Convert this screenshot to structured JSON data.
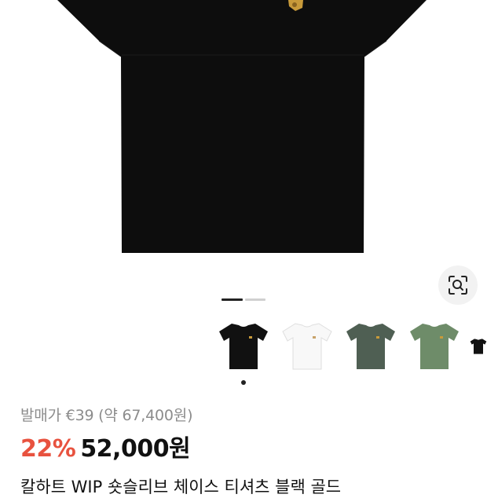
{
  "product": {
    "image": {
      "alt": "black t-shirt product photo",
      "color": "#0d0d0d"
    },
    "lens_icon": "visual-search-icon",
    "carousel": {
      "current": 1,
      "total": 2
    },
    "variants": [
      {
        "name": "black",
        "color": "#111111"
      },
      {
        "name": "white",
        "color": "#f8f8f8"
      },
      {
        "name": "dark-green",
        "color": "#4f5f53"
      },
      {
        "name": "green",
        "color": "#6e8c69"
      },
      {
        "name": "black-2",
        "color": "#111111"
      }
    ],
    "original_price": "발매가 €39 (약 67,400원)",
    "discount": "22%",
    "price": "52,000원",
    "title": "칼하트 WIP 숏슬리브 체이스 티셔츠 블랙 골드"
  }
}
